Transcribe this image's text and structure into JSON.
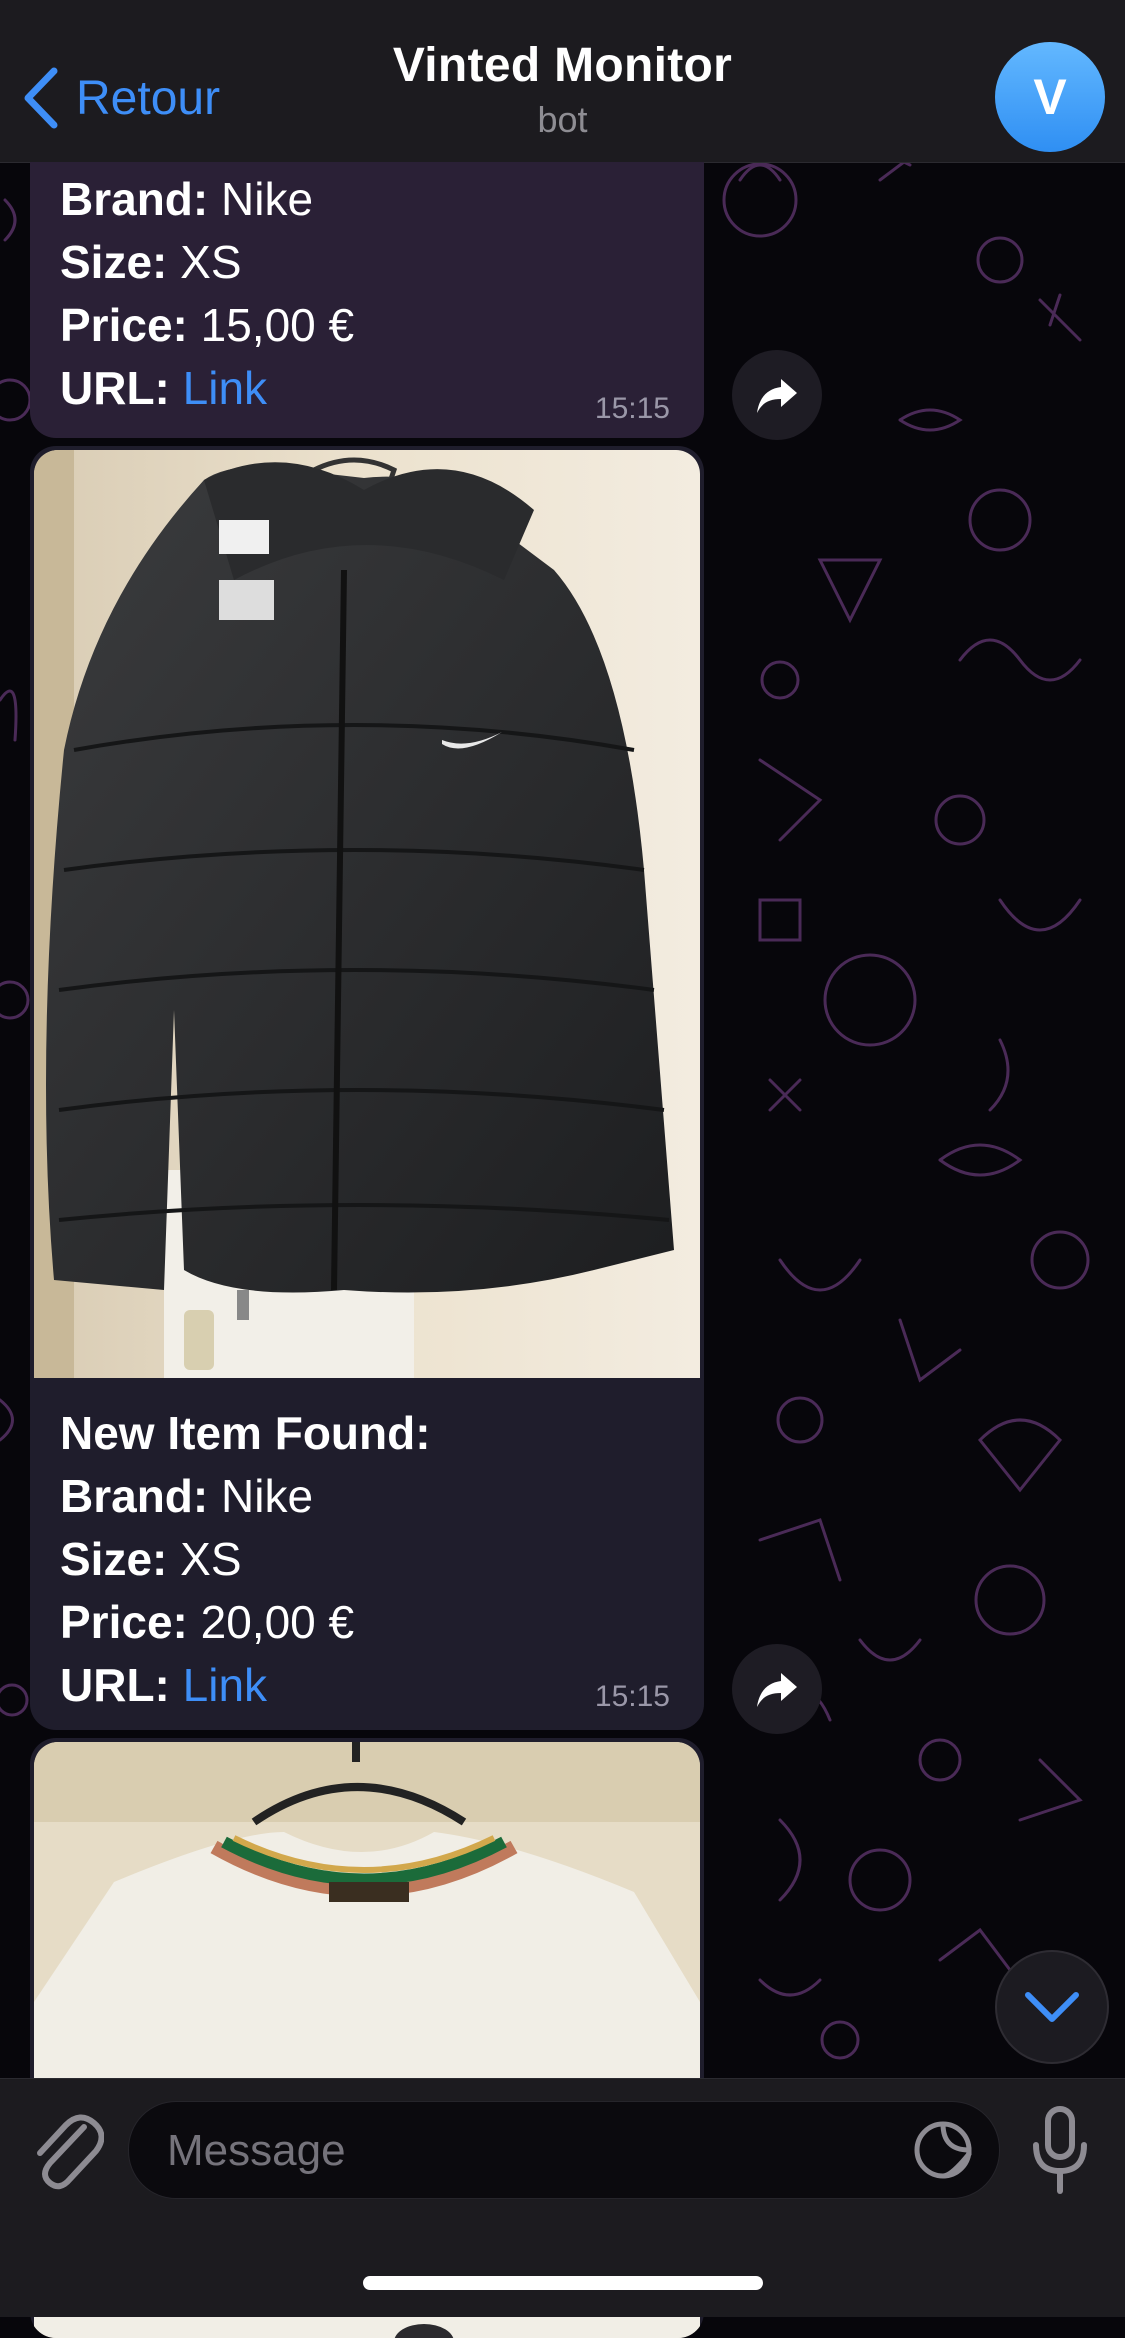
{
  "header": {
    "back_label": "Retour",
    "title": "Vinted Monitor",
    "subtitle": "bot",
    "avatar_letter": "V"
  },
  "messages": [
    {
      "lines": [
        {
          "key": "Brand:",
          "value": "Nike"
        },
        {
          "key": "Size:",
          "value": "XS"
        },
        {
          "key": "Price:",
          "value": "15,00 €"
        }
      ],
      "url_key": "URL:",
      "url_label": "Link",
      "time": "15:15"
    },
    {
      "heading": "New Item Found:",
      "photo": "black-puffer-jacket-photo",
      "lines": [
        {
          "key": "Brand:",
          "value": "Nike"
        },
        {
          "key": "Size:",
          "value": "XS"
        },
        {
          "key": "Price:",
          "value": "20,00 €"
        }
      ],
      "url_key": "URL:",
      "url_label": "Link",
      "time": "15:15"
    },
    {
      "photo": "white-tshirt-on-hanger-photo"
    }
  ],
  "composer": {
    "placeholder": "Message"
  },
  "colors": {
    "accent": "#3e8ef7",
    "bubble": "#1f1d2c",
    "header_bg": "#1c1b1f"
  }
}
